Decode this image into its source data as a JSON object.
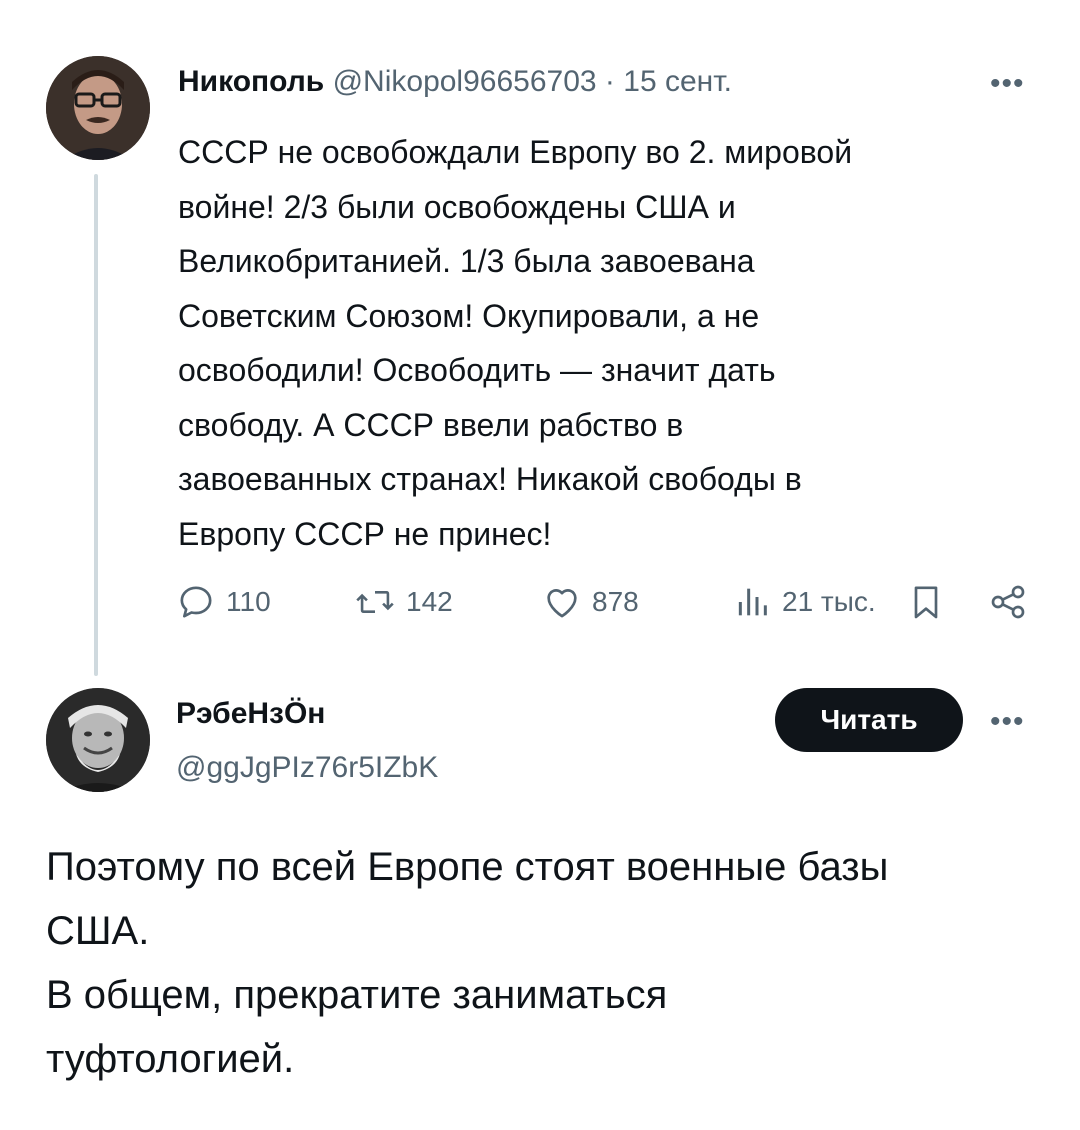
{
  "tweet": {
    "author_name": "Никополь",
    "handle": "@Nikopol96656703",
    "separator": "·",
    "date": "15 сент.",
    "more_label": "•••",
    "text": "СССР не освобождали Европу во 2. мировой\nвойне! 2/3 были освобождены США и\nВеликобританией. 1/3 была завоевана\nСоветским Союзом! Окупировали, а не\nосвободили! Освободить — значит дать\nсвободу. А СССР ввели рабство в\nзавоеванных странах! Никакой свободы в\nЕвропу СССР не принес!",
    "stats": {
      "replies": "110",
      "reposts": "142",
      "likes": "878",
      "views": "21 тыс."
    }
  },
  "reply": {
    "author_name": "РэбеНзÖн",
    "handle": "@ggJgPIz76r5IZbK",
    "follow_label": "Читать",
    "more_label": "•••",
    "text": "Поэтому по всей Европе стоят военные базы\nСША.\nВ общем, прекратите заниматься\nтуфтологией."
  },
  "colors": {
    "text": "#0f1419",
    "muted": "#536471",
    "thread_line": "#cfd9de",
    "button_bg": "#0f1419",
    "button_text": "#ffffff"
  },
  "icons": [
    "reply-icon",
    "repost-icon",
    "like-icon",
    "views-icon",
    "bookmark-icon",
    "share-icon",
    "more-icon"
  ]
}
